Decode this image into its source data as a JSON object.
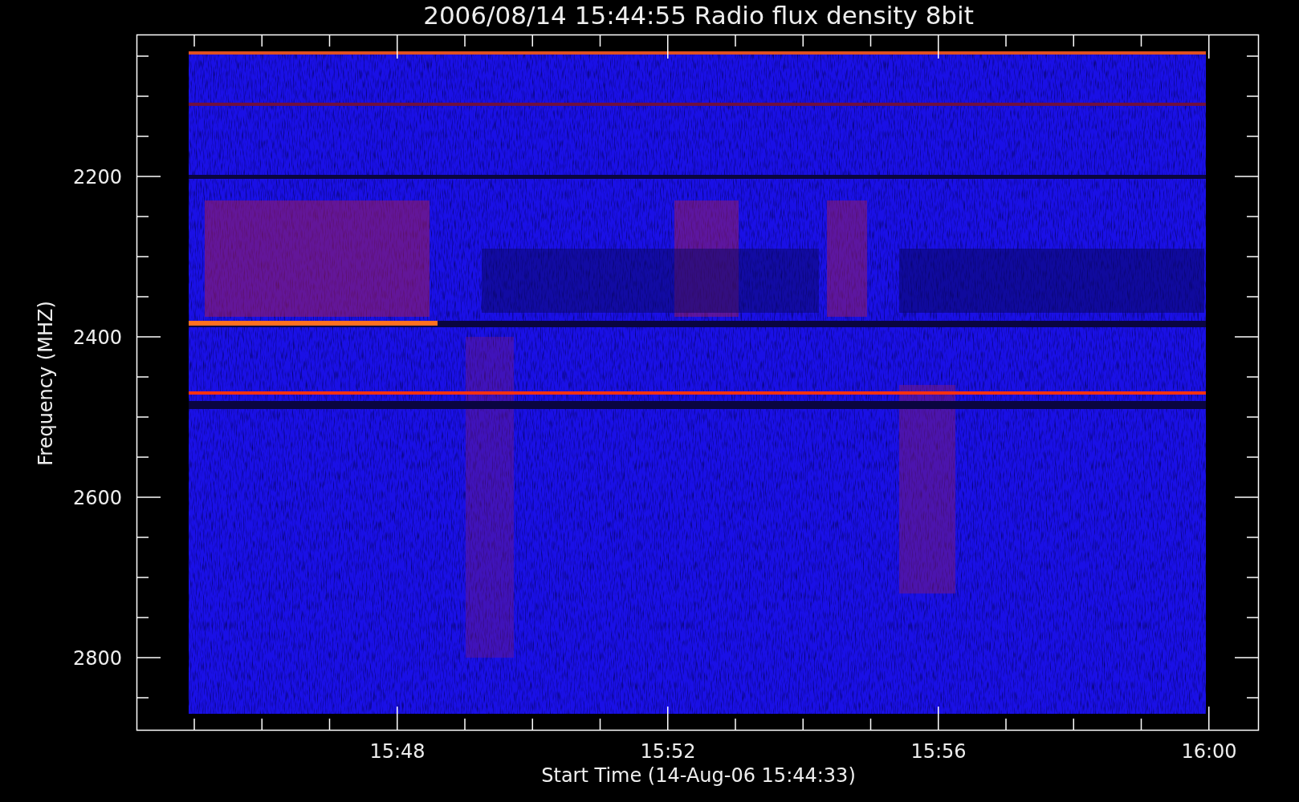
{
  "plot": {
    "title": "2006/08/14 15:44:55 Radio flux density 8bit",
    "ylabel": "Frequency (MHZ)",
    "xlabel": "Start Time (14-Aug-06 15:44:33)",
    "yticks": [
      "2200",
      "2400",
      "2600",
      "2800"
    ],
    "xticks": [
      "15:48",
      "15:52",
      "15:56",
      "16:00"
    ]
  }
}
